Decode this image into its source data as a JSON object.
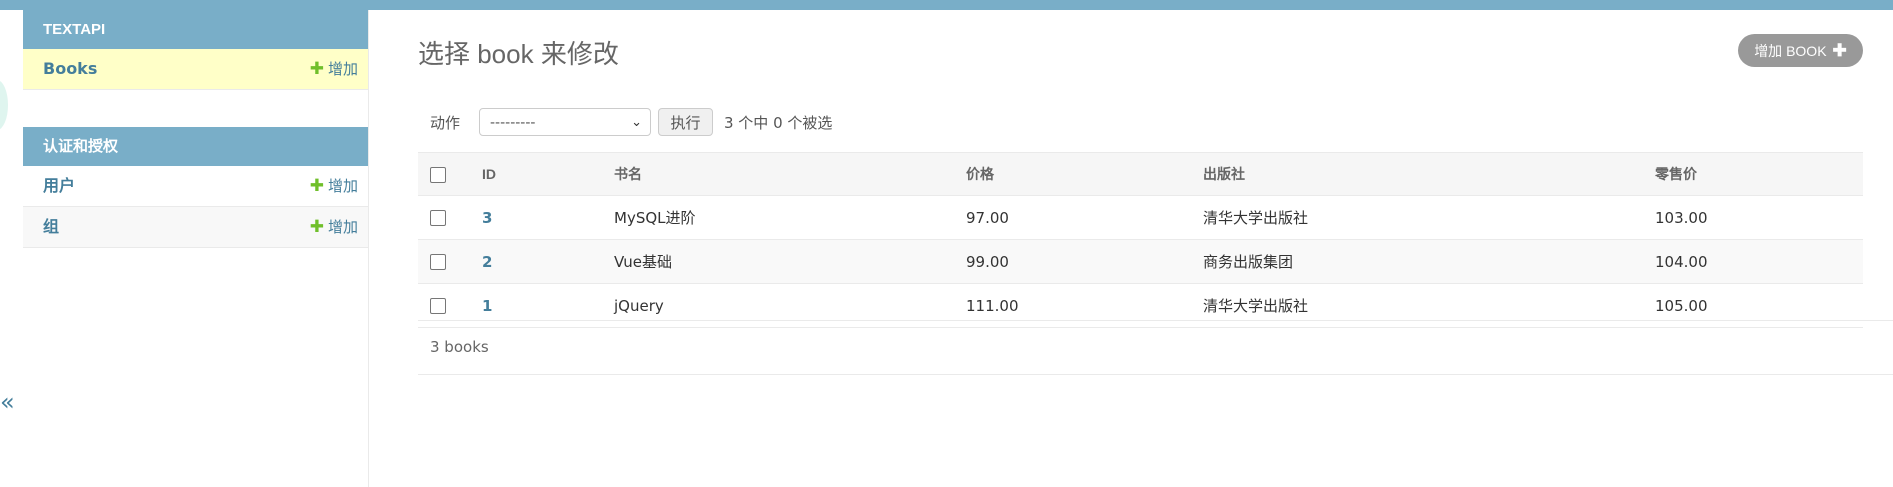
{
  "sidebar": {
    "modules": [
      {
        "caption": "TEXTAPI",
        "items": [
          {
            "label": "Books",
            "add_label": "增加"
          }
        ]
      },
      {
        "caption": "认证和授权",
        "items": [
          {
            "label": "用户",
            "add_label": "增加"
          },
          {
            "label": "组",
            "add_label": "增加"
          }
        ]
      }
    ],
    "toggle_glyph": "«"
  },
  "main": {
    "title": "选择 book 来修改",
    "add_button_label": "增加 BOOK",
    "actions": {
      "label": "动作",
      "selected_option": "---------",
      "go_label": "执行",
      "counter": "3 个中 0 个被选"
    },
    "table": {
      "columns": [
        "ID",
        "书名",
        "价格",
        "出版社",
        "零售价"
      ],
      "rows": [
        {
          "id": "3",
          "name": "MySQL进阶",
          "price": "97.00",
          "publisher": "清华大学出版社",
          "retail": "103.00"
        },
        {
          "id": "2",
          "name": "Vue基础",
          "price": "99.00",
          "publisher": "商务出版集团",
          "retail": "104.00"
        },
        {
          "id": "1",
          "name": "jQuery",
          "price": "111.00",
          "publisher": "清华大学出版社",
          "retail": "105.00"
        }
      ]
    },
    "footer_count": "3 books"
  },
  "colors": {
    "header": "#79aec8",
    "link": "#447e9b",
    "add_green": "#70bf2b",
    "selected_row": "#ffffc8",
    "button_grey": "#999999"
  }
}
